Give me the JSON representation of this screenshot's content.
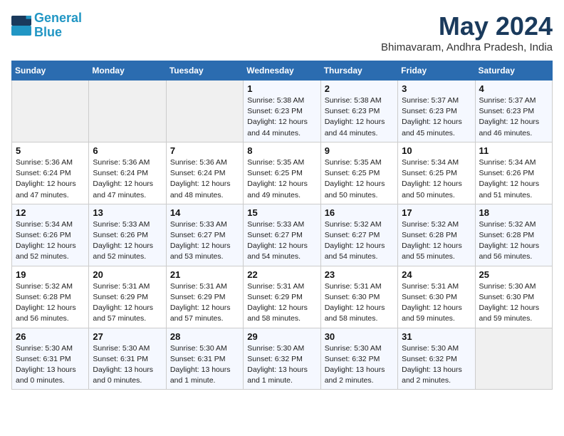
{
  "header": {
    "logo_line1": "General",
    "logo_line2": "Blue",
    "title": "May 2024",
    "subtitle": "Bhimavaram, Andhra Pradesh, India"
  },
  "weekdays": [
    "Sunday",
    "Monday",
    "Tuesday",
    "Wednesday",
    "Thursday",
    "Friday",
    "Saturday"
  ],
  "weeks": [
    [
      {
        "day": "",
        "info": ""
      },
      {
        "day": "",
        "info": ""
      },
      {
        "day": "",
        "info": ""
      },
      {
        "day": "1",
        "info": "Sunrise: 5:38 AM\nSunset: 6:23 PM\nDaylight: 12 hours\nand 44 minutes."
      },
      {
        "day": "2",
        "info": "Sunrise: 5:38 AM\nSunset: 6:23 PM\nDaylight: 12 hours\nand 44 minutes."
      },
      {
        "day": "3",
        "info": "Sunrise: 5:37 AM\nSunset: 6:23 PM\nDaylight: 12 hours\nand 45 minutes."
      },
      {
        "day": "4",
        "info": "Sunrise: 5:37 AM\nSunset: 6:23 PM\nDaylight: 12 hours\nand 46 minutes."
      }
    ],
    [
      {
        "day": "5",
        "info": "Sunrise: 5:36 AM\nSunset: 6:24 PM\nDaylight: 12 hours\nand 47 minutes."
      },
      {
        "day": "6",
        "info": "Sunrise: 5:36 AM\nSunset: 6:24 PM\nDaylight: 12 hours\nand 47 minutes."
      },
      {
        "day": "7",
        "info": "Sunrise: 5:36 AM\nSunset: 6:24 PM\nDaylight: 12 hours\nand 48 minutes."
      },
      {
        "day": "8",
        "info": "Sunrise: 5:35 AM\nSunset: 6:25 PM\nDaylight: 12 hours\nand 49 minutes."
      },
      {
        "day": "9",
        "info": "Sunrise: 5:35 AM\nSunset: 6:25 PM\nDaylight: 12 hours\nand 50 minutes."
      },
      {
        "day": "10",
        "info": "Sunrise: 5:34 AM\nSunset: 6:25 PM\nDaylight: 12 hours\nand 50 minutes."
      },
      {
        "day": "11",
        "info": "Sunrise: 5:34 AM\nSunset: 6:26 PM\nDaylight: 12 hours\nand 51 minutes."
      }
    ],
    [
      {
        "day": "12",
        "info": "Sunrise: 5:34 AM\nSunset: 6:26 PM\nDaylight: 12 hours\nand 52 minutes."
      },
      {
        "day": "13",
        "info": "Sunrise: 5:33 AM\nSunset: 6:26 PM\nDaylight: 12 hours\nand 52 minutes."
      },
      {
        "day": "14",
        "info": "Sunrise: 5:33 AM\nSunset: 6:27 PM\nDaylight: 12 hours\nand 53 minutes."
      },
      {
        "day": "15",
        "info": "Sunrise: 5:33 AM\nSunset: 6:27 PM\nDaylight: 12 hours\nand 54 minutes."
      },
      {
        "day": "16",
        "info": "Sunrise: 5:32 AM\nSunset: 6:27 PM\nDaylight: 12 hours\nand 54 minutes."
      },
      {
        "day": "17",
        "info": "Sunrise: 5:32 AM\nSunset: 6:28 PM\nDaylight: 12 hours\nand 55 minutes."
      },
      {
        "day": "18",
        "info": "Sunrise: 5:32 AM\nSunset: 6:28 PM\nDaylight: 12 hours\nand 56 minutes."
      }
    ],
    [
      {
        "day": "19",
        "info": "Sunrise: 5:32 AM\nSunset: 6:28 PM\nDaylight: 12 hours\nand 56 minutes."
      },
      {
        "day": "20",
        "info": "Sunrise: 5:31 AM\nSunset: 6:29 PM\nDaylight: 12 hours\nand 57 minutes."
      },
      {
        "day": "21",
        "info": "Sunrise: 5:31 AM\nSunset: 6:29 PM\nDaylight: 12 hours\nand 57 minutes."
      },
      {
        "day": "22",
        "info": "Sunrise: 5:31 AM\nSunset: 6:29 PM\nDaylight: 12 hours\nand 58 minutes."
      },
      {
        "day": "23",
        "info": "Sunrise: 5:31 AM\nSunset: 6:30 PM\nDaylight: 12 hours\nand 58 minutes."
      },
      {
        "day": "24",
        "info": "Sunrise: 5:31 AM\nSunset: 6:30 PM\nDaylight: 12 hours\nand 59 minutes."
      },
      {
        "day": "25",
        "info": "Sunrise: 5:30 AM\nSunset: 6:30 PM\nDaylight: 12 hours\nand 59 minutes."
      }
    ],
    [
      {
        "day": "26",
        "info": "Sunrise: 5:30 AM\nSunset: 6:31 PM\nDaylight: 13 hours\nand 0 minutes."
      },
      {
        "day": "27",
        "info": "Sunrise: 5:30 AM\nSunset: 6:31 PM\nDaylight: 13 hours\nand 0 minutes."
      },
      {
        "day": "28",
        "info": "Sunrise: 5:30 AM\nSunset: 6:31 PM\nDaylight: 13 hours\nand 1 minute."
      },
      {
        "day": "29",
        "info": "Sunrise: 5:30 AM\nSunset: 6:32 PM\nDaylight: 13 hours\nand 1 minute."
      },
      {
        "day": "30",
        "info": "Sunrise: 5:30 AM\nSunset: 6:32 PM\nDaylight: 13 hours\nand 2 minutes."
      },
      {
        "day": "31",
        "info": "Sunrise: 5:30 AM\nSunset: 6:32 PM\nDaylight: 13 hours\nand 2 minutes."
      },
      {
        "day": "",
        "info": ""
      }
    ]
  ]
}
